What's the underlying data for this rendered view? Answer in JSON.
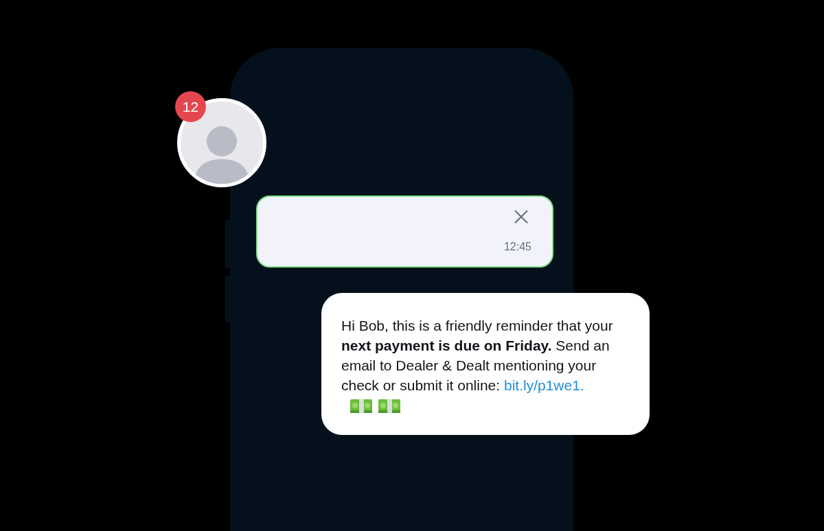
{
  "contact": {
    "badge": "12"
  },
  "draft_bubble": {
    "time": "12:45",
    "outlined": true
  },
  "message": {
    "body": "Hi Bob, this is a friendly reminder that your **next payment is due on Friday.** Send an email to Dealer & Dealt mentioning your check or submit it online:",
    "link": "bit.ly/p1we1.",
    "emojis": [
      {
        "kind": "money"
      },
      {
        "kind": "money"
      }
    ]
  }
}
